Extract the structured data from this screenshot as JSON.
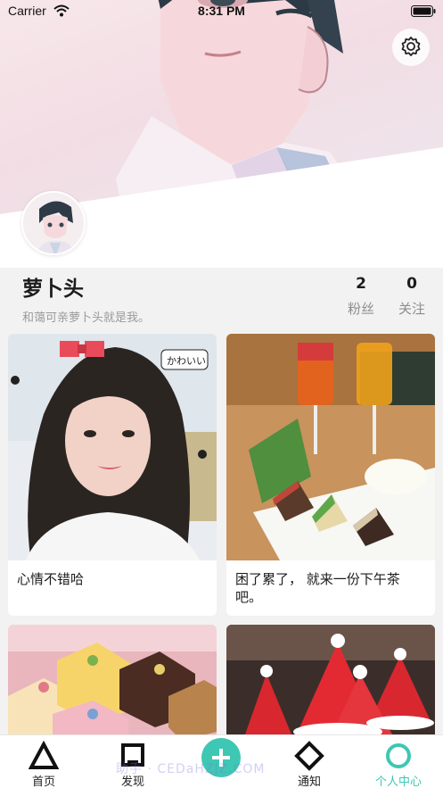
{
  "status_bar": {
    "carrier": "Carrier",
    "time": "8:31 PM"
  },
  "profile": {
    "name": "萝卜头",
    "bio": "和蔼可亲萝卜头就是我。",
    "fans_count": "2",
    "fans_label": "粉丝",
    "following_count": "0",
    "following_label": "关注"
  },
  "feed": [
    {
      "caption": "心情不错哈"
    },
    {
      "caption": "困了累了， 就来一份下午茶吧。"
    },
    {
      "caption": ""
    },
    {
      "caption": ""
    }
  ],
  "tabbar": {
    "home_label": "首页",
    "discover_label": "发现",
    "notify_label": "通知",
    "me_label": "个人中心"
  },
  "watermark": "助手 · CEDaHZJZ.COM",
  "colors": {
    "accent": "#3ec7b3",
    "muted_text": "#9a9a9a"
  },
  "icons": {
    "settings": "gear-icon",
    "home": "triangle-icon",
    "discover": "square-icon",
    "post": "plus-icon",
    "notify": "diamond-icon",
    "me": "circle-icon"
  }
}
